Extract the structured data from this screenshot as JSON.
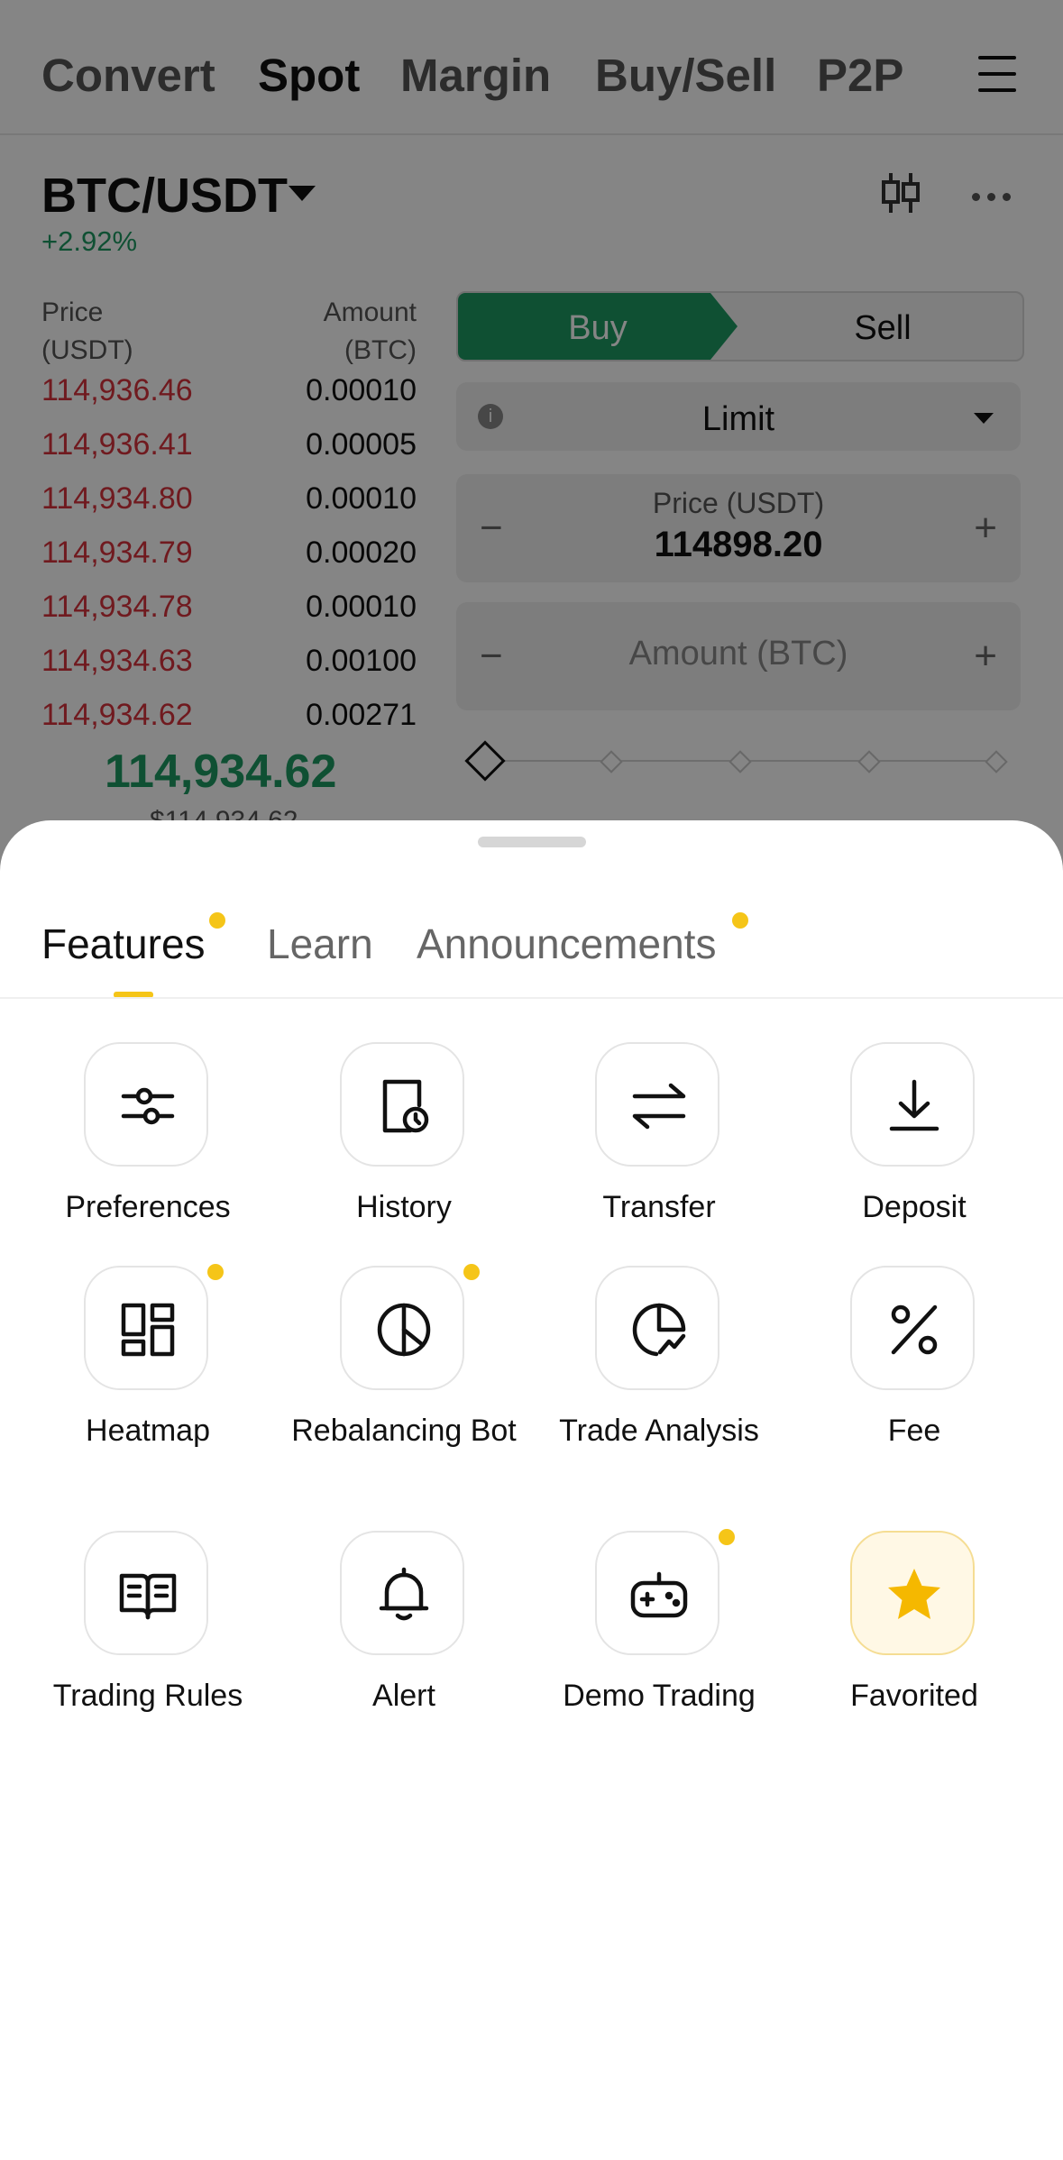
{
  "nav": {
    "tabs": [
      {
        "label": "Convert"
      },
      {
        "label": "Spot"
      },
      {
        "label": "Margin"
      },
      {
        "label": "Buy/Sell"
      },
      {
        "label": "P2P"
      }
    ],
    "active": "Spot"
  },
  "market": {
    "pair": "BTC/USDT",
    "change": "+2.92%"
  },
  "orderbook": {
    "price_header": "Price\n(USDT)",
    "amount_header": "Amount\n(BTC)",
    "asks": [
      {
        "price": "114,936.46",
        "amount": "0.00010"
      },
      {
        "price": "114,936.41",
        "amount": "0.00005"
      },
      {
        "price": "114,934.80",
        "amount": "0.00010"
      },
      {
        "price": "114,934.79",
        "amount": "0.00020"
      },
      {
        "price": "114,934.78",
        "amount": "0.00010"
      },
      {
        "price": "114,934.63",
        "amount": "0.00100"
      },
      {
        "price": "114,934.62",
        "amount": "0.00271"
      }
    ],
    "last_price": "114,934.62",
    "last_price_usd": "$114,934.62"
  },
  "order_form": {
    "buy_label": "Buy",
    "sell_label": "Sell",
    "order_type": "Limit",
    "price_label": "Price (USDT)",
    "price_value": "114898.20",
    "amount_placeholder": "Amount (BTC)",
    "minus": "−",
    "plus": "+"
  },
  "sheet": {
    "tabs": [
      {
        "label": "Features",
        "has_dot": true
      },
      {
        "label": "Learn",
        "has_dot": false
      },
      {
        "label": "Announcements",
        "has_dot": true
      }
    ],
    "active_tab": "Features",
    "features": [
      {
        "label": "Preferences",
        "icon": "sliders-icon",
        "badge": false
      },
      {
        "label": "History",
        "icon": "history-icon",
        "badge": false
      },
      {
        "label": "Transfer",
        "icon": "transfer-icon",
        "badge": false
      },
      {
        "label": "Deposit",
        "icon": "deposit-icon",
        "badge": false
      },
      {
        "label": "Heatmap",
        "icon": "heatmap-icon",
        "badge": true
      },
      {
        "label": "Rebalancing Bot",
        "icon": "pie-chart-icon",
        "badge": true
      },
      {
        "label": "Trade Analysis",
        "icon": "trade-analysis-icon",
        "badge": false
      },
      {
        "label": "Fee",
        "icon": "percent-icon",
        "badge": false
      },
      {
        "label": "Trading Rules",
        "icon": "book-icon",
        "badge": false
      },
      {
        "label": "Alert",
        "icon": "bell-icon",
        "badge": false
      },
      {
        "label": "Demo Trading",
        "icon": "gamepad-icon",
        "badge": true
      },
      {
        "label": "Favorited",
        "icon": "star-icon",
        "badge": false
      }
    ]
  },
  "colors": {
    "up": "#1d9a63",
    "down": "#d6323d",
    "accent": "#f5c518"
  }
}
